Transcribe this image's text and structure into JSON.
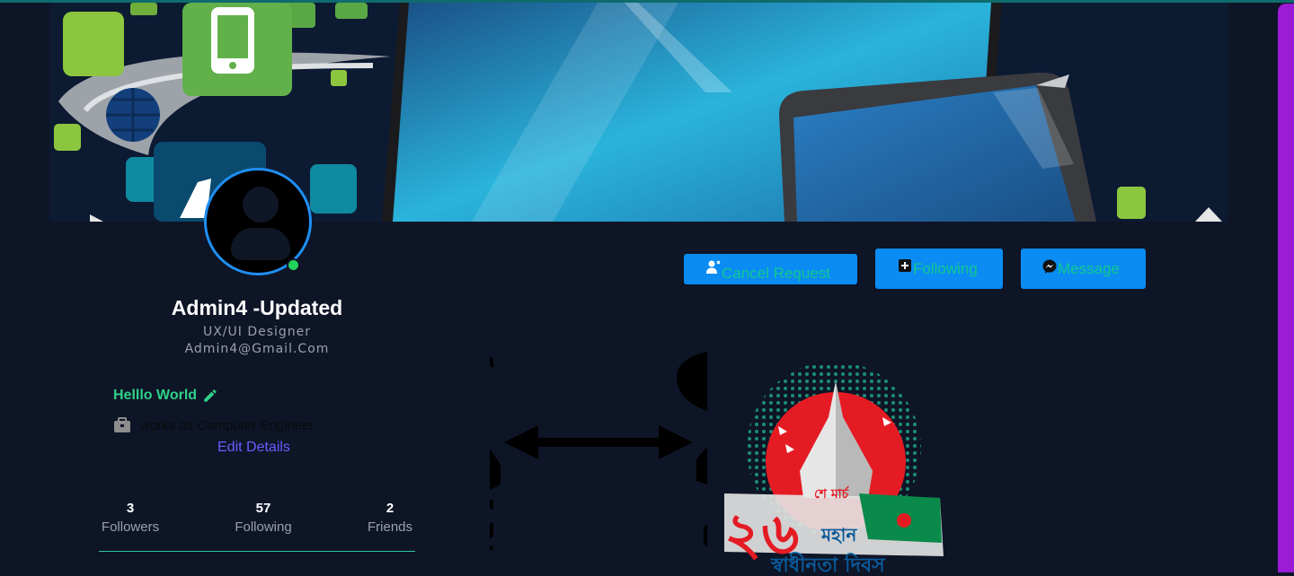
{
  "profile": {
    "name": "Admin4 -Updated",
    "role": "UX/UI Designer",
    "email": "Admin4@Gmail.Com",
    "bio": "Helllo World",
    "work": "works as Computer Engineer",
    "edit_details": "Edit Details",
    "online": true
  },
  "stats": [
    {
      "value": "3",
      "label": "Followers"
    },
    {
      "value": "57",
      "label": "Following"
    },
    {
      "value": "2",
      "label": "Friends"
    }
  ],
  "actions": {
    "cancel_request": "Cancel Request",
    "following": "Following",
    "message": "Message"
  },
  "poster": {
    "line1": "২৬",
    "line2": "শে মার্চ",
    "line3": "মহান",
    "line4": "স্বাধীনতা দিবস"
  },
  "colors": {
    "background": "#0e1527",
    "accent": "#0a8cf3",
    "button_text": "#12c88f",
    "online": "#22d35a",
    "link": "#6a5cff",
    "scrollbar": "#9b1cd6"
  },
  "icons": [
    "user-x-icon",
    "add-box-icon",
    "messenger-icon",
    "pencil-icon",
    "briefcase-icon"
  ]
}
